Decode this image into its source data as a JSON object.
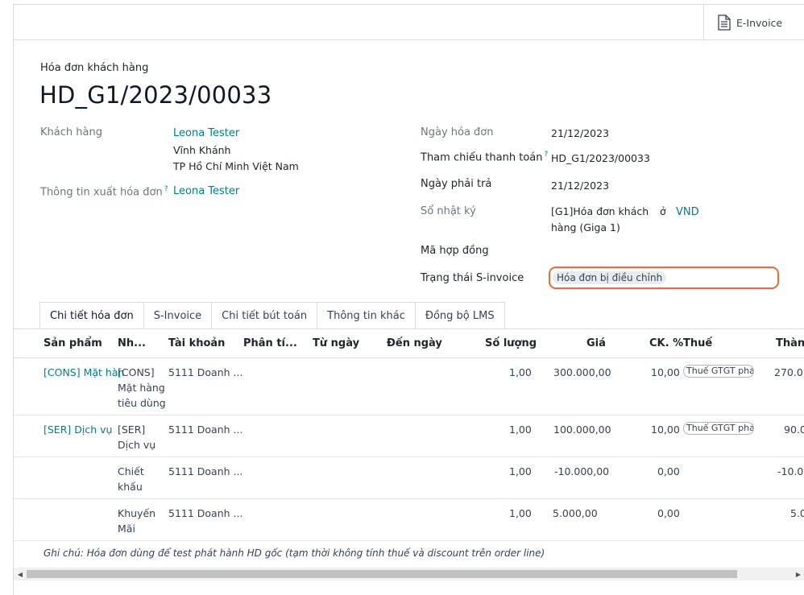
{
  "toolbar": {
    "einvoice_label": "E-Invoice",
    "einvoice_icon": "document-icon"
  },
  "header": {
    "subtitle": "Hóa đơn khách hàng",
    "title": "HD_G1/2023/00033"
  },
  "left": {
    "customer_label": "Khách hàng",
    "customer_name": "Leona Tester",
    "customer_addr1": "Vĩnh Khánh",
    "customer_addr2": "TP Hồ Chí Minh Việt Nam",
    "invoice_info_label": "Thông tin xuất hóa đơn",
    "invoice_info_value": "Leona Tester",
    "help_mark": "?"
  },
  "right": {
    "invoice_date_label": "Ngày hóa đơn",
    "invoice_date": "21/12/2023",
    "payment_ref_label": "Tham chiếu thanh toán",
    "payment_ref": "HD_G1/2023/00033",
    "due_date_label": "Ngày phải trả",
    "due_date": "21/12/2023",
    "journal_label": "Sổ nhật ký",
    "journal_line1": "[G1]Hóa đơn khách",
    "journal_line2": "hàng (Giga 1)",
    "in_word": "ở",
    "currency": "VND",
    "contract_label": "Mã hợp đồng",
    "sinvoice_status_label": "Trạng thái S-invoice",
    "sinvoice_status": "Hóa đơn bị điều chỉnh"
  },
  "tabs": [
    "Chi tiết hóa đơn",
    "S-Invoice",
    "Chi tiết bút toán",
    "Thông tin khác",
    "Đồng bộ LMS"
  ],
  "table": {
    "headers": {
      "product": "Sản phẩm",
      "label": "Nh...",
      "account": "Tài khoản",
      "analytic": "Phân tí...",
      "from": "Từ ngày",
      "to": "Đến ngày",
      "qty": "Số lượng",
      "price": "Giá",
      "disc": "CK. %",
      "tax": "Thuế",
      "total": "Thành"
    },
    "rows": [
      {
        "product": "[CONS] Mặt hàn",
        "label1": "[CONS]",
        "label2": "Mặt hàng",
        "label3": "tiêu dùng",
        "account": "5111 Doanh ...",
        "qty": "1,00",
        "price": "300.000,00",
        "disc": "10,00",
        "tax": "Thuế GTGT phả",
        "total": "270.0"
      },
      {
        "product": "[SER] Dịch vụ",
        "label1": "[SER]",
        "label2": "Dịch vụ",
        "label3": "",
        "account": "5111 Doanh ...",
        "qty": "1,00",
        "price": "100.000,00",
        "disc": "10,00",
        "tax": "Thuế GTGT phả",
        "total": "90.0"
      },
      {
        "product": "",
        "label1": "Chiết",
        "label2": "khấu",
        "label3": "",
        "account": "5111 Doanh ...",
        "qty": "1,00",
        "price": "-10.000,00",
        "disc": "0,00",
        "tax": "",
        "total": "-10.0"
      },
      {
        "product": "",
        "label1": "Khuyến",
        "label2": "Mãi",
        "label3": "",
        "account": "5111 Doanh ...",
        "qty": "1,00",
        "price": "5.000,00",
        "disc": "0,00",
        "tax": "",
        "total": "5.0"
      }
    ],
    "note": "Ghi chú: Hóa đơn dùng để test phát hành HD gốc (tạm thời không tính thuế và discount trên order line)"
  },
  "scrollbar": {
    "left_arrow": "◀",
    "right_arrow": "▶"
  },
  "colors": {
    "link": "#017e84",
    "status_outline": "#ec6a3c",
    "badge_bg": "#e9ecef"
  }
}
